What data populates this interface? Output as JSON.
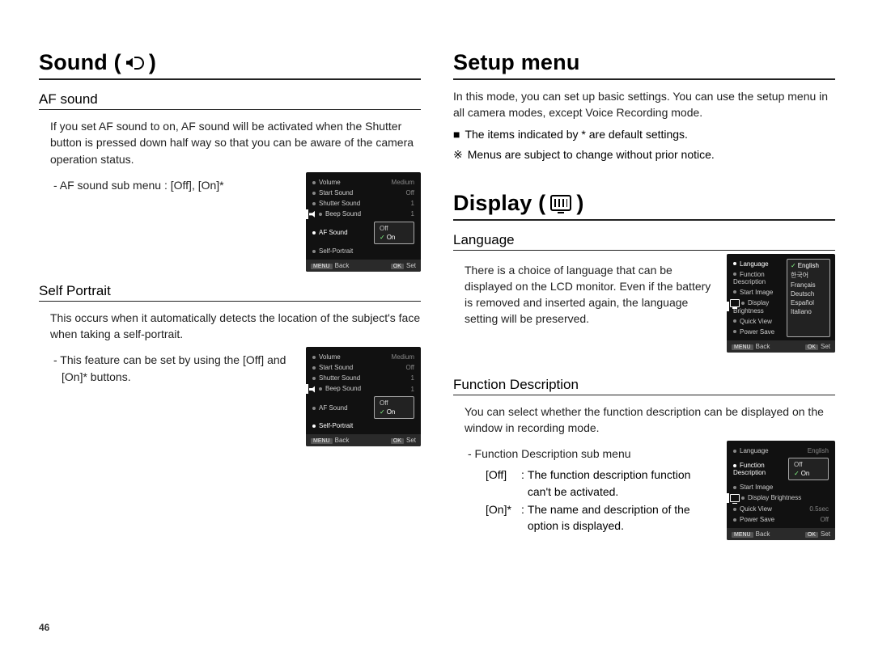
{
  "page_number": "46",
  "left": {
    "title_prefix": "Sound (",
    "title_suffix": ")",
    "af_sound": {
      "heading": "AF sound",
      "body": "If you set AF sound to on, AF sound will be activated when the Shutter button is pressed down half way so that you can be aware of the camera operation status.",
      "submenu_line": "- AF sound sub menu : [Off], [On]*"
    },
    "self_portrait": {
      "heading": "Self Portrait",
      "body": "This occurs when it automatically detects the location of the subject's face when taking a self-portrait.",
      "submenu_line": "- This feature can be set by using the [Off] and [On]* buttons."
    },
    "lcd_sound": {
      "rows": [
        {
          "l": "Volume",
          "r": "Medium"
        },
        {
          "l": "Start Sound",
          "r": "Off"
        },
        {
          "l": "Shutter Sound",
          "r": "1"
        },
        {
          "l": "Beep Sound",
          "r": "1"
        },
        {
          "l": "AF Sound",
          "r": ""
        },
        {
          "l": "Self-Portrait",
          "r": ""
        }
      ],
      "options": {
        "off": "Off",
        "on": "On"
      },
      "footer": {
        "back_btn": "MENU",
        "back": "Back",
        "ok_btn": "OK",
        "ok": "Set"
      },
      "highlight_af": true
    },
    "lcd_self": {
      "rows": [
        {
          "l": "Volume",
          "r": "Medium"
        },
        {
          "l": "Start Sound",
          "r": "Off"
        },
        {
          "l": "Shutter Sound",
          "r": "1"
        },
        {
          "l": "Beep Sound",
          "r": "1"
        },
        {
          "l": "AF Sound",
          "r": ""
        },
        {
          "l": "Self-Portrait",
          "r": ""
        }
      ],
      "options": {
        "off": "Off",
        "on": "On"
      },
      "footer": {
        "back_btn": "MENU",
        "back": "Back",
        "ok_btn": "OK",
        "ok": "Set"
      },
      "highlight_self": true
    }
  },
  "right": {
    "setup": {
      "title": "Setup menu",
      "body": "In this mode, you can set up basic settings. You can use the setup menu in all camera modes, except Voice Recording mode.",
      "bullet1_sym": "■",
      "bullet1": "The items indicated by * are default settings.",
      "bullet2_sym": "※",
      "bullet2": "Menus are subject to change without prior notice."
    },
    "display": {
      "title_prefix": "Display (",
      "title_suffix": ")",
      "language": {
        "heading": "Language",
        "body": "There is a choice of language that can be displayed on the LCD monitor. Even if the battery is removed and inserted again, the language setting will be preserved."
      },
      "fd": {
        "heading": "Function Description",
        "body": "You can select whether the function description can be displayed on the window in recording mode.",
        "submenu_title": "- Function Description sub menu",
        "off_tag": "[Off]",
        "off_sep": ":",
        "off_desc": "The function description function can't be activated.",
        "on_tag": "[On]*",
        "on_sep": ":",
        "on_desc": "The name and description of the option is displayed."
      }
    },
    "lcd_lang": {
      "rows": [
        {
          "l": "Language"
        },
        {
          "l": "Function Description"
        },
        {
          "l": "Start Image"
        },
        {
          "l": "Display Brightness"
        },
        {
          "l": "Quick View"
        },
        {
          "l": "Power Save"
        }
      ],
      "langs": [
        "English",
        "한국어",
        "Français",
        "Deutsch",
        "Español",
        "Italiano"
      ],
      "footer": {
        "back_btn": "MENU",
        "back": "Back",
        "ok_btn": "OK",
        "ok": "Set"
      }
    },
    "lcd_fd": {
      "rows": [
        {
          "l": "Language",
          "r": "English"
        },
        {
          "l": "Function Description",
          "r": ""
        },
        {
          "l": "Start Image",
          "r": ""
        },
        {
          "l": "Display Brightness",
          "r": ""
        },
        {
          "l": "Quick View",
          "r": "0.5sec"
        },
        {
          "l": "Power Save",
          "r": "Off"
        }
      ],
      "options": {
        "off": "Off",
        "on": "On"
      },
      "footer": {
        "back_btn": "MENU",
        "back": "Back",
        "ok_btn": "OK",
        "ok": "Set"
      }
    }
  }
}
